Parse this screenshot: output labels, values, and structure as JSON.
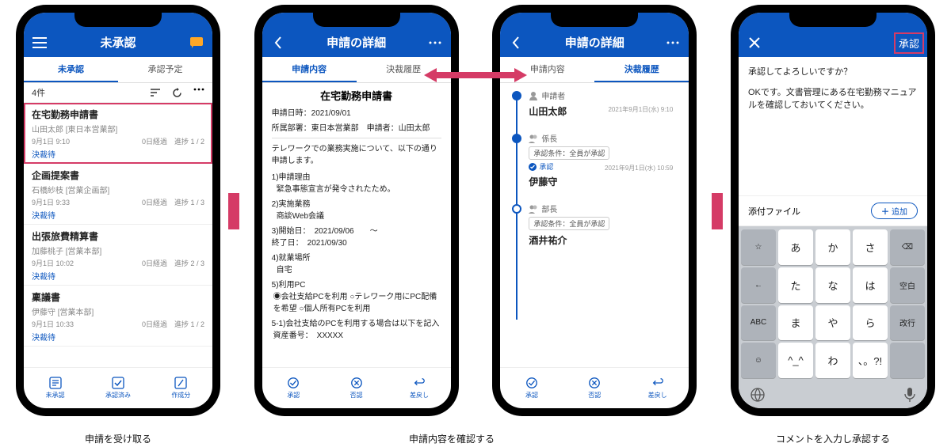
{
  "captions": {
    "c1": "申請を受け取る",
    "c2": "申請内容を確認する",
    "c3": "コメントを入力し承認する"
  },
  "p1": {
    "title": "未承認",
    "tabs": [
      "未承認",
      "承認予定"
    ],
    "count": "4件",
    "items": [
      {
        "title": "在宅勤務申請書",
        "sub": "山田太郎 [東日本営業部]",
        "date": "9月1日 9:10",
        "elapsed": "0日経過",
        "prog": "進捗 1 / 2",
        "status": "決裁待"
      },
      {
        "title": "企画提案書",
        "sub": "石橋紗枝 [営業企画部]",
        "date": "9月1日 9:33",
        "elapsed": "0日経過",
        "prog": "進捗 1 / 3",
        "status": "決裁待"
      },
      {
        "title": "出張旅費精算書",
        "sub": "加藤桃子 [営業本部]",
        "date": "9月1日 10:02",
        "elapsed": "0日経過",
        "prog": "進捗 2 / 3",
        "status": "決裁待"
      },
      {
        "title": "稟議書",
        "sub": "伊藤守 [営業本部]",
        "date": "9月1日 10:33",
        "elapsed": "0日経過",
        "prog": "進捗 1 / 2",
        "status": "決裁待"
      }
    ],
    "nav": [
      "未承認",
      "承認済み",
      "作成分"
    ]
  },
  "p2": {
    "title": "申請の詳細",
    "tabs": [
      "申請内容",
      "決裁履歴"
    ],
    "doc_title": "在宅勤務申請書",
    "fields": {
      "date_lbl": "申請日時：",
      "date": "2021/09/01",
      "dept_lbl": "所属部署：",
      "dept": "東日本営業部",
      "applicant_lbl": "申請者：",
      "applicant": "山田太郎",
      "body": "テレワークでの業務実施について、以下の通り申請します。",
      "r1_lbl": "1)申請理由",
      "r1": "緊急事態宣言が発令されたため。",
      "r2_lbl": "2)実施業務",
      "r2": "商談Web会議",
      "r3_lbl": "3)開始日：",
      "r3": "2021/09/06",
      "r3_tilde": "～",
      "r3b_lbl": "終了日：",
      "r3b": "2021/09/30",
      "r4_lbl": "4)就業場所",
      "r4": "自宅",
      "r5_lbl": "5)利用PC",
      "r5a": "会社支給PCを利用",
      "r5b": "テレワーク用にPC配備を希望",
      "r5c": "個人所有PCを利用",
      "r6_lbl": "5-1)会社支給のPCを利用する場合は以下を記入",
      "r6a": "資産番号：",
      "r6b": "XXXXX"
    },
    "nav": [
      "承認",
      "否認",
      "差戻し"
    ]
  },
  "p3": {
    "title": "申請の詳細",
    "tabs": [
      "申請内容",
      "決裁履歴"
    ],
    "applicant_lbl": "申請者",
    "step1": {
      "date": "2021年9月1日(水) 9:10",
      "name": "山田太郎"
    },
    "step2": {
      "role": "係長",
      "cond": "承認条件：全員が承認",
      "appr": "承認",
      "date": "2021年9月1日(水) 10:59",
      "name": "伊藤守"
    },
    "step3": {
      "role": "部長",
      "cond": "承認条件：全員が承認",
      "name": "酒井祐介"
    },
    "nav": [
      "承認",
      "否認",
      "差戻し"
    ]
  },
  "p4": {
    "title": "承認",
    "q": "承認してよろしいですか？",
    "msg": "OKです。文書管理にある在宅勤務マニュアルを確認しておいてください。",
    "attach": "添付ファイル",
    "add": "追加",
    "kbd": {
      "r1": [
        "☆",
        "あ",
        "か",
        "さ",
        "⌫"
      ],
      "r2": [
        "←",
        "た",
        "な",
        "は",
        "空白"
      ],
      "r3": [
        "ABC",
        "ま",
        "や",
        "ら",
        "改行"
      ],
      "r4": [
        "☺",
        "^_^",
        "わ",
        "、。?!",
        ""
      ]
    }
  }
}
